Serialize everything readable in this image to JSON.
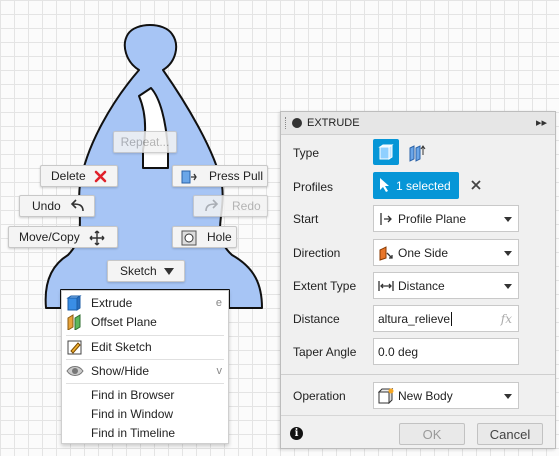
{
  "marking_menu": {
    "repeat_label": "Repeat...",
    "delete_label": "Delete",
    "press_pull_label": "Press Pull",
    "undo_label": "Undo",
    "redo_label": "Redo",
    "move_copy_label": "Move/Copy",
    "hole_label": "Hole",
    "sketch_label": "Sketch"
  },
  "context_menu": {
    "items": [
      {
        "label": "Extrude",
        "shortcut": "e",
        "icon": "extrude-icon"
      },
      {
        "label": "Offset Plane",
        "icon": "offset-plane-icon"
      },
      {
        "label": "Edit Sketch",
        "icon": "edit-sketch-icon"
      },
      {
        "label": "Show/Hide",
        "shortcut": "v",
        "icon": "eye-icon"
      },
      {
        "label": "Find in Browser"
      },
      {
        "label": "Find in Window"
      },
      {
        "label": "Find in Timeline"
      }
    ]
  },
  "extrude_panel": {
    "title": "EXTRUDE",
    "type_label": "Type",
    "profiles_label": "Profiles",
    "profiles_value": "1 selected",
    "start_label": "Start",
    "start_value": "Profile Plane",
    "direction_label": "Direction",
    "direction_value": "One Side",
    "extent_type_label": "Extent Type",
    "extent_type_value": "Distance",
    "distance_label": "Distance",
    "distance_value": "altura_relieve",
    "fx_label": "fx",
    "taper_angle_label": "Taper Angle",
    "taper_angle_value": "0.0 deg",
    "operation_label": "Operation",
    "operation_value": "New Body",
    "ok_label": "OK",
    "cancel_label": "Cancel"
  },
  "colors": {
    "sketch_fill": "#a7c5f5",
    "accent_blue": "#0696d7",
    "delete_red": "#e0202a"
  }
}
